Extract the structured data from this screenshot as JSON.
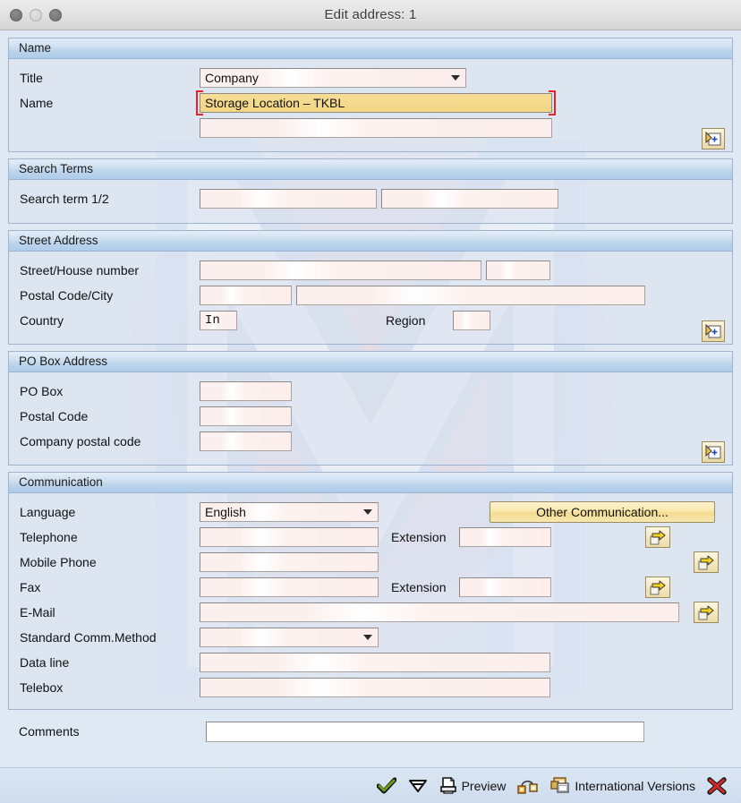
{
  "window": {
    "title": "Edit address:  1",
    "traffic_lights": [
      "close",
      "minimize",
      "maximize"
    ]
  },
  "sections": {
    "name": {
      "header": "Name",
      "title_label": "Title",
      "title_value": "Company",
      "name_label": "Name",
      "name_value": "Storage Location – TKBL",
      "name2_value": ""
    },
    "search_terms": {
      "header": "Search Terms",
      "search_label": "Search term 1/2",
      "search1_value": "",
      "search2_value": ""
    },
    "street_address": {
      "header": "Street Address",
      "street_label": "Street/House number",
      "street_value": "",
      "house_value": "",
      "postal_city_label": "Postal Code/City",
      "postal_value": "",
      "city_value": "",
      "country_label": "Country",
      "country_value": "In",
      "region_label": "Region",
      "region_value": ""
    },
    "po_box": {
      "header": "PO Box Address",
      "po_box_label": "PO Box",
      "po_box_value": "",
      "postal_code_label": "Postal Code",
      "postal_code_value": "",
      "company_postal_label": "Company postal code",
      "company_postal_value": ""
    },
    "communication": {
      "header": "Communication",
      "language_label": "Language",
      "language_value": "English",
      "other_comm_button": "Other Communication...",
      "telephone_label": "Telephone",
      "telephone_value": "",
      "extension_label": "Extension",
      "telephone_ext_value": "",
      "mobile_label": "Mobile Phone",
      "mobile_value": "",
      "fax_label": "Fax",
      "fax_value": "",
      "fax_ext_label": "Extension",
      "fax_ext_value": "",
      "email_label": "E-Mail",
      "email_value": "",
      "std_comm_label": "Standard Comm.Method",
      "std_comm_value": "",
      "data_line_label": "Data line",
      "data_line_value": "",
      "telebox_label": "Telebox",
      "telebox_value": ""
    }
  },
  "comments": {
    "label": "Comments",
    "value": ""
  },
  "toolbar": {
    "continue_icon": "check-icon",
    "enter_icon": "enter-arrow-icon",
    "preview_label": "Preview",
    "preview_icon": "printer-icon",
    "address_link_icon": "address-link-icon",
    "international_versions_label": "International Versions",
    "international_versions_icon": "windows-stack-icon",
    "cancel_icon": "close-x-icon"
  },
  "colors": {
    "accent_blue": "#aeccea",
    "highlight_yellow": "#f4d98c",
    "focus_red": "#ee2222",
    "input_pink": "#fbeeec",
    "check_green": "#4f8a10",
    "cancel_red": "#cc2b2b"
  }
}
